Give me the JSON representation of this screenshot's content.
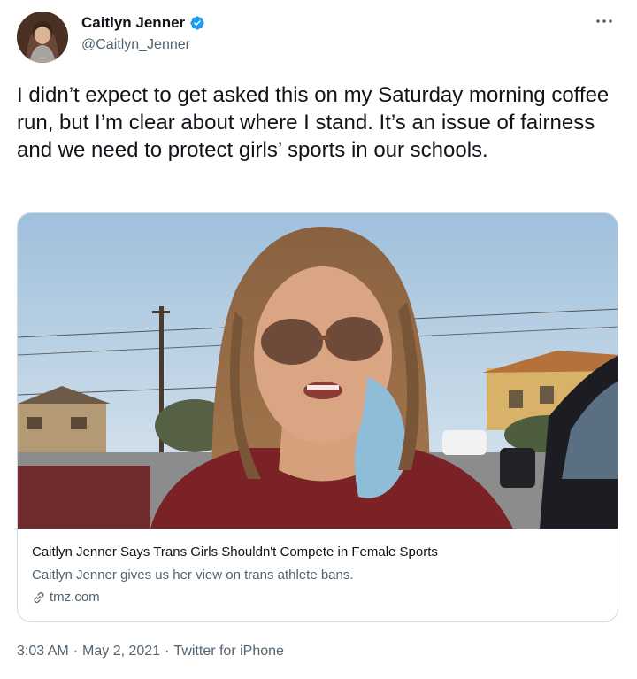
{
  "author": {
    "display_name": "Caitlyn Jenner",
    "handle": "@Caitlyn_Jenner",
    "verified": true
  },
  "tweet": {
    "text": "I didn’t expect to get asked this on my Saturday morning coffee run, but I’m clear about where I stand. It’s an issue of fairness and we need to protect girls’ sports in our schools."
  },
  "card": {
    "title": "Caitlyn Jenner Says Trans Girls Shouldn't Compete in Female Sports",
    "description": "Caitlyn Jenner gives us her view on trans athlete bans.",
    "domain": "tmz.com"
  },
  "meta": {
    "time": "3:03 AM",
    "separator": "·",
    "date": "May 2, 2021",
    "source": "Twitter for iPhone"
  },
  "icons": {
    "verified": "verified-badge-icon",
    "more": "more-dots-icon",
    "link": "link-icon"
  },
  "colors": {
    "verified": "#1d9bf0",
    "secondary_text": "#536471",
    "primary_text": "#0f1419",
    "border": "#cfd9de"
  }
}
